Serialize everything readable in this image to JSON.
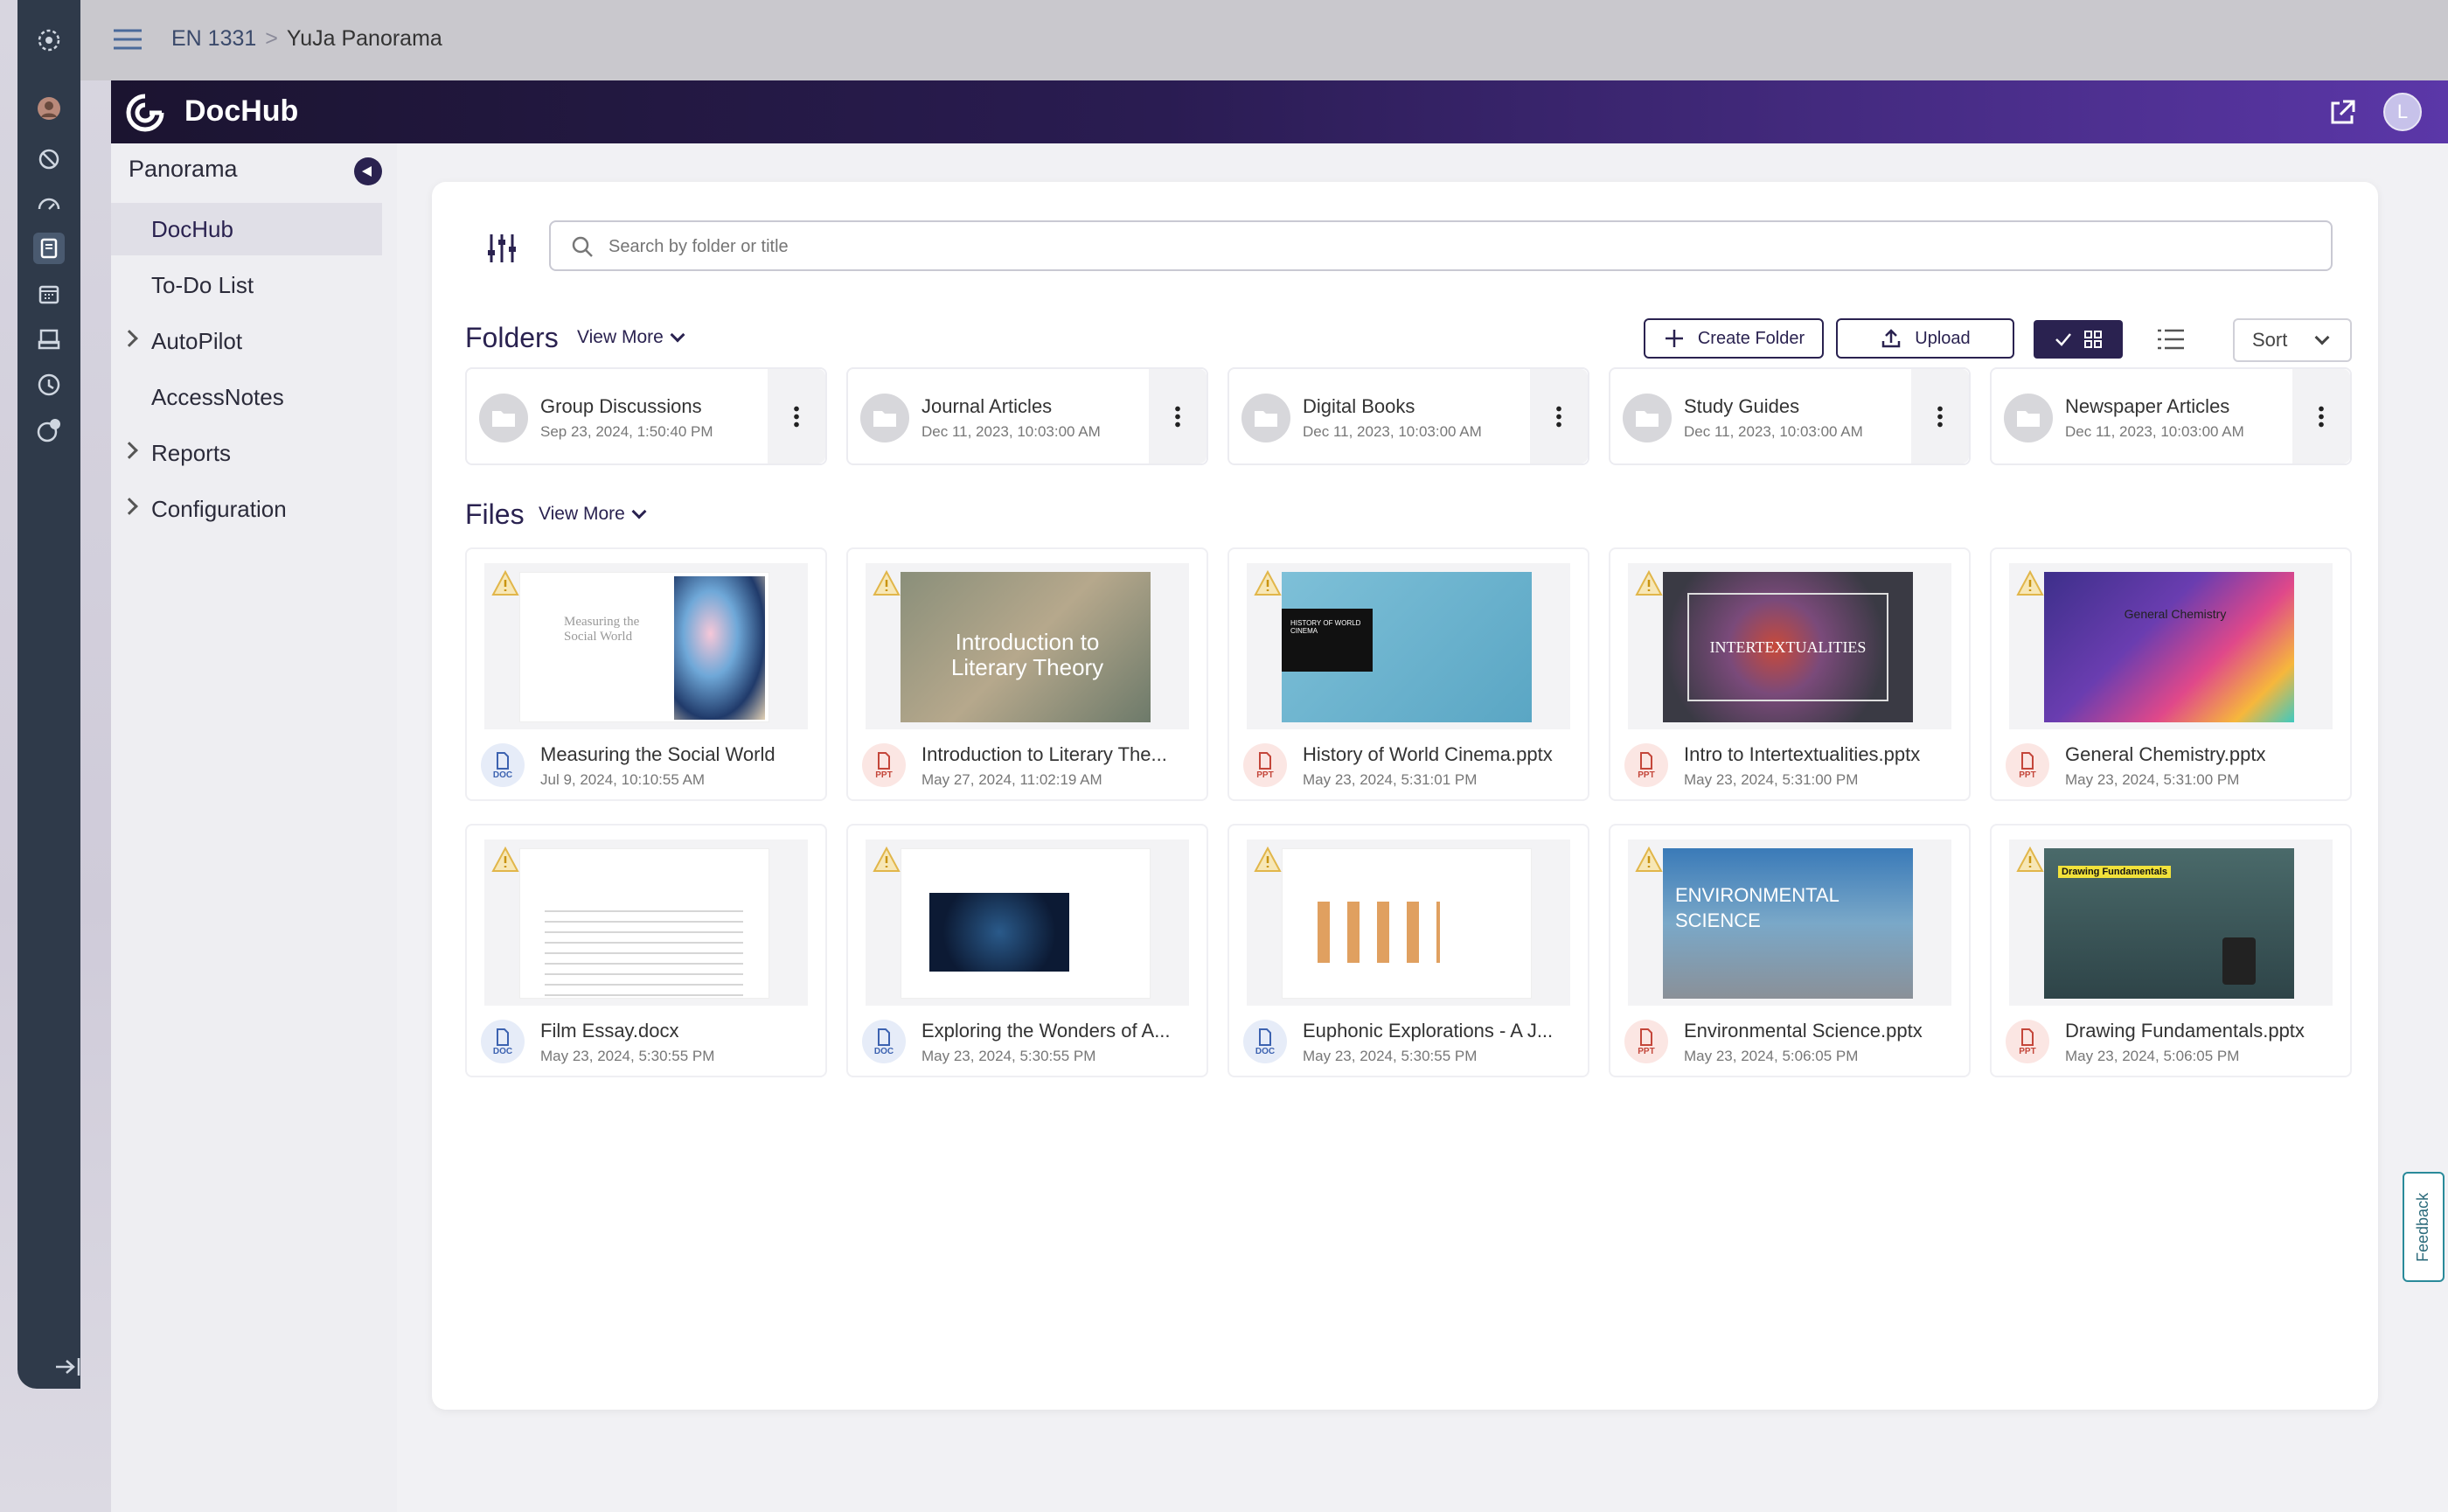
{
  "breadcrumb": {
    "course": "EN 1331",
    "separator": ">",
    "page": "YuJa Panorama"
  },
  "app": {
    "title": "DocHub",
    "user_initial": "L"
  },
  "sidebar": {
    "header": "Panorama",
    "items": [
      {
        "label": "DocHub",
        "active": true,
        "expandable": false
      },
      {
        "label": "To-Do List",
        "active": false,
        "expandable": false
      },
      {
        "label": "AutoPilot",
        "active": false,
        "expandable": true
      },
      {
        "label": "AccessNotes",
        "active": false,
        "expandable": false
      },
      {
        "label": "Reports",
        "active": false,
        "expandable": true
      },
      {
        "label": "Configuration",
        "active": false,
        "expandable": true
      }
    ]
  },
  "search": {
    "placeholder": "Search by folder or title"
  },
  "folders": {
    "title": "Folders",
    "view_more": "View More",
    "items": [
      {
        "name": "Group Discussions",
        "date": "Sep 23, 2024, 1:50:40 PM"
      },
      {
        "name": "Journal Articles",
        "date": "Dec 11, 2023, 10:03:00 AM"
      },
      {
        "name": "Digital Books",
        "date": "Dec 11, 2023, 10:03:00 AM"
      },
      {
        "name": "Study Guides",
        "date": "Dec 11, 2023, 10:03:00 AM"
      },
      {
        "name": "Newspaper Articles",
        "date": "Dec 11, 2023, 10:03:00 AM"
      }
    ]
  },
  "toolbar": {
    "create_folder": "Create Folder",
    "upload": "Upload",
    "sort": "Sort"
  },
  "files": {
    "title": "Files",
    "view_more": "View More",
    "items": [
      {
        "name": "Measuring the Social World",
        "date": "Jul 9, 2024, 10:10:55 AM",
        "type": "DOC",
        "thumb_text": "Measuring the Social World"
      },
      {
        "name": "Introduction to Literary The...",
        "date": "May 27, 2024, 11:02:19 AM",
        "type": "PPT",
        "thumb_text": "Introduction to Literary Theory"
      },
      {
        "name": "History of World Cinema.pptx",
        "date": "May 23, 2024, 5:31:01 PM",
        "type": "PPT",
        "thumb_text": "HISTORY OF WORLD CINEMA"
      },
      {
        "name": "Intro to Intertextualities.pptx",
        "date": "May 23, 2024, 5:31:00 PM",
        "type": "PPT",
        "thumb_text": "INTERTEXTUALITIES"
      },
      {
        "name": "General Chemistry.pptx",
        "date": "May 23, 2024, 5:31:00 PM",
        "type": "PPT",
        "thumb_text": "General Chemistry"
      },
      {
        "name": "Film Essay.docx",
        "date": "May 23, 2024, 5:30:55 PM",
        "type": "DOC",
        "thumb_text": ""
      },
      {
        "name": "Exploring the Wonders of A...",
        "date": "May 23, 2024, 5:30:55 PM",
        "type": "DOC",
        "thumb_text": ""
      },
      {
        "name": "Euphonic Explorations - A J...",
        "date": "May 23, 2024, 5:30:55 PM",
        "type": "DOC",
        "thumb_text": ""
      },
      {
        "name": "Environmental Science.pptx",
        "date": "May 23, 2024, 5:06:05 PM",
        "type": "PPT",
        "thumb_text": "ENVIRONMENTAL SCIENCE"
      },
      {
        "name": "Drawing Fundamentals.pptx",
        "date": "May 23, 2024, 5:06:05 PM",
        "type": "PPT",
        "thumb_text": "Drawing Fundamentals"
      }
    ]
  },
  "feedback": "Feedback",
  "colors": {
    "brand_dark": "#2a2250",
    "header_accent": "#5b37a8",
    "doc_blue": "#3c62b0",
    "ppt_red": "#c4463a"
  }
}
